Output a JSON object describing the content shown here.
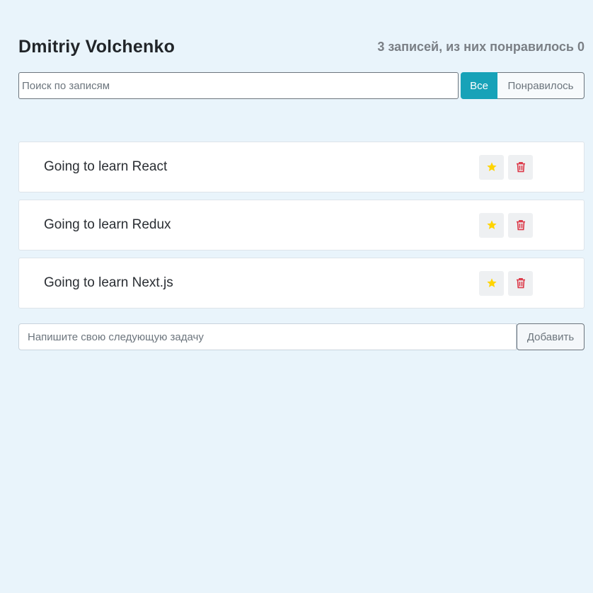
{
  "header": {
    "user_name": "Dmitriy Volchenko",
    "stats": "3 записей, из них понравилось 0"
  },
  "search": {
    "placeholder": "Поиск по записям",
    "value": ""
  },
  "filters": {
    "all_label": "Все",
    "liked_label": "Понравилось",
    "active": "all"
  },
  "tasks": [
    {
      "label": "Going to learn React",
      "liked": false
    },
    {
      "label": "Going to learn Redux",
      "liked": false
    },
    {
      "label": "Going to learn Next.js",
      "liked": false
    }
  ],
  "add_form": {
    "placeholder": "Напишите свою следующую задачу",
    "value": "",
    "button_label": "Добавить"
  },
  "icons": {
    "like": "star-icon",
    "delete": "trash-icon"
  },
  "colors": {
    "background": "#e9f4fb",
    "accent": "#17a2b8",
    "star": "#ffd400",
    "trash": "#dc3545"
  }
}
